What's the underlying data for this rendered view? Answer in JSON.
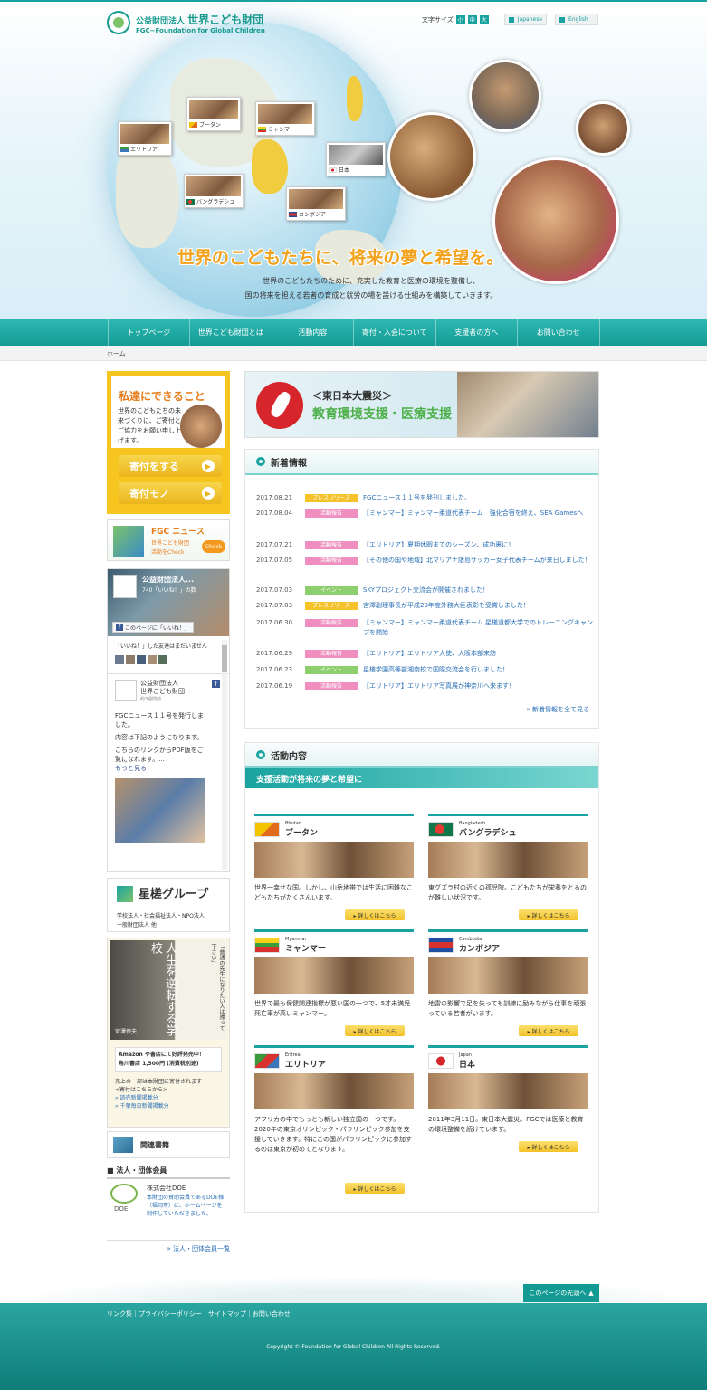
{
  "header": {
    "logo_sub": "公益財団法人",
    "logo_name": "世界こども財団",
    "logo_en": "FGC−Foundation for Global Children",
    "font_size_label": "文字サイズ",
    "font_sizes": [
      "小",
      "中",
      "大"
    ],
    "lang_japanese": "Japanese",
    "lang_english": "English"
  },
  "hero": {
    "countries": [
      "ブータン",
      "エリトリア",
      "ミャンマー",
      "日本",
      "バングラデシュ",
      "カンボジア"
    ],
    "tagline": "世界のこどもたちに、将来の夢と希望を。",
    "sub1": "世界のこどもたちのために、充実した教育と医療の環境を整備し、",
    "sub2": "国の将来を担える若者の育成と就労の場を設ける仕組みを構築していきます。"
  },
  "nav": [
    "トップページ",
    "世界こども財団とは",
    "活動内容",
    "寄付・入会について",
    "支援者の方へ",
    "お問い合わせ"
  ],
  "breadcrumb": "ホーム",
  "sidebar": {
    "can_title": "私達にできること",
    "can_text": "世界のこどもたちの未来づくりに、ご寄付とご協力をお願い申し上げます。",
    "donate": "寄付をする",
    "donate_goods": "寄付モノ",
    "fgc_news_title": "FGC ニュース",
    "fgc_news_sub1": "世界こども財団",
    "fgc_news_sub2": "活動をCheck",
    "check": "Check",
    "fb_title": "公益財団法人...",
    "fb_likes": "740「いいね！」の数",
    "fb_like_page": "このページに「いいね！」",
    "fb_friends": "「いいね！」した友達はまだいません",
    "fb_page_name1": "公益財団法人",
    "fb_page_name2": "世界こども財団",
    "fb_time": "約3週間前",
    "fb_post1": "FGCニュース１１号を発行しました。",
    "fb_post2": "内容は下記のようになります。",
    "fb_post3": "こちらのリンクからPDF版をご覧になれます。...",
    "fb_more": "もっと見る",
    "seiryo_title": "星槎グループ",
    "seiryo_text1": "学校法人・社会福祉法人・NPO法人",
    "seiryo_text2": "一般財団法人 他",
    "book_title": "人生を逆転する学校",
    "book_quote": "「普通の先生になりたい人は帰って下さい」",
    "book_author": "宮澤保夫",
    "book_sale1": "Amazon や書店にて好評発売中！",
    "book_sale2": "角川書店 1,500円 (消費税別途)",
    "book_note1": "売上の一部は本財団に寄付されます",
    "book_note2": "<寄付はこちらから>",
    "book_link1": "» 読売新聞掲載分",
    "book_link2": "» 千葉毎日新聞掲載分",
    "related_books": "関連書籍",
    "members_title": "■ 法人・団体会員",
    "doe_name": "株式会社DOE",
    "doe_logo": "DOE",
    "doe_text": "本財団の賛助会員であるDOE様（福岡市）に、ホームページを制作していただきました。",
    "members_more": "» 法人・団体会員一覧"
  },
  "banner": {
    "line1": "＜東日本大震災＞",
    "line2": "教育環境支援・医療支援"
  },
  "news": {
    "title": "新着情報",
    "items": [
      {
        "date": "2017.08.21",
        "cat": "プレスリリース",
        "type": "press",
        "title": "FGCニュース１１号を発刊しました。"
      },
      {
        "date": "2017.08.04",
        "cat": "活動報告",
        "type": "act",
        "title": "【ミャンマー】ミャンマー柔道代表チーム　強化合宿を終え、SEA Gamesへ"
      },
      {
        "date": "2017.07.21",
        "cat": "活動報告",
        "type": "act",
        "title": "【エリトリア】夏期休暇までのシーズン、成功裏に！"
      },
      {
        "date": "2017.07.05",
        "cat": "活動報告",
        "type": "act",
        "title": "【その他の国や地域】北マリアナ諸島サッカー女子代表チームが来日しました！"
      },
      {
        "date": "2017.07.03",
        "cat": "イベント",
        "type": "ev",
        "title": "SKYプロジェクト交流会が開催されました！"
      },
      {
        "date": "2017.07.03",
        "cat": "プレスリリース",
        "type": "press",
        "title": "宮澤副理事長が平成29年度外務大臣表彰を受賞しました！"
      },
      {
        "date": "2017.06.30",
        "cat": "活動報告",
        "type": "act",
        "title": "【ミャンマー】ミャンマー柔道代表チーム 星槎道都大学でのトレーニングキャンプを開始"
      },
      {
        "date": "2017.06.29",
        "cat": "活動報告",
        "type": "act",
        "title": "【エリトリア】エリトリア大使、大阪本部来訪"
      },
      {
        "date": "2017.06.23",
        "cat": "イベント",
        "type": "ev",
        "title": "星槎学園高等部湘南校で国際交流会を行いました！"
      },
      {
        "date": "2017.06.19",
        "cat": "活動報告",
        "type": "act",
        "title": "【エリトリア】エリトリア写真展が神奈川へ来ます！"
      }
    ],
    "more": "» 新着情報を全て見る"
  },
  "activities": {
    "title": "活動内容",
    "banner": "支援活動が将来の夢と希望に",
    "detail": "詳しくはこちら",
    "items": [
      {
        "en": "Bhutan",
        "jp": "ブータン",
        "desc": "世界一幸せな国。しかし、山岳地帯では生活に困難なこどもたちがたくさんいます。"
      },
      {
        "en": "Bangladesh",
        "jp": "バングラデシュ",
        "desc": "東グズラ村の近くの孤児院。こどもたちが栄養をとるのが難しい状況です。"
      },
      {
        "en": "Myanmar",
        "jp": "ミャンマー",
        "desc": "世界で最も保健関連指標が悪い国の一つで、5才未満児死亡率が高いミャンマー。"
      },
      {
        "en": "Cambodia",
        "jp": "カンボジア",
        "desc": "地雷の影響で足を失っても訓練に励みながら仕事を頑張っている若者がいます。"
      },
      {
        "en": "Eritrea",
        "jp": "エリトリア",
        "desc": "アフリカの中でもっとも新しい独立国の一つです。2020年の東京オリンピック・パラリンピック参加を支援していきます。特にこの国がパラリンピックに参加するのは東京が初めてとなります。"
      },
      {
        "en": "Japan",
        "jp": "日本",
        "desc": "2011年3月11日。東日本大震災。FGCでは医療と教育の環境整備を続けています。"
      }
    ]
  },
  "footer": {
    "links": "リンク集｜プライバシーポリシー｜サイトマップ｜お問い合わせ",
    "pagetop": "このページの先頭へ",
    "copyright": "Copyright © Foundation for Global Children All Rights Reserved."
  },
  "colors": {
    "accent": "#19a3a0",
    "orange": "#f2a21c",
    "yellow": "#f6c51f"
  }
}
